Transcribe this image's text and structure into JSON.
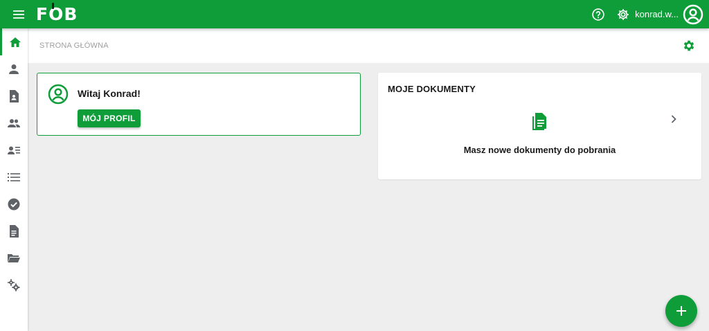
{
  "app": {
    "logo_text": "FOB",
    "brand_color": "#0f9d3a"
  },
  "header": {
    "menu_icon": "hamburger-icon",
    "help_icon": "help-circle-icon",
    "settings_icon": "gear-icon",
    "username": "konrad.w...",
    "avatar_icon": "account-circle-icon"
  },
  "sidebar": {
    "items": [
      {
        "name": "home",
        "icon": "home-icon",
        "active": true
      },
      {
        "name": "profile",
        "icon": "person-icon",
        "active": false
      },
      {
        "name": "document-person",
        "icon": "document-person-icon",
        "active": false
      },
      {
        "name": "people",
        "icon": "people-icon",
        "active": false
      },
      {
        "name": "contacts",
        "icon": "contact-list-icon",
        "active": false
      },
      {
        "name": "list",
        "icon": "list-icon",
        "active": false
      },
      {
        "name": "tasks",
        "icon": "check-circle-icon",
        "active": false
      },
      {
        "name": "documents",
        "icon": "document-icon",
        "active": false
      },
      {
        "name": "folders",
        "icon": "folder-open-icon",
        "active": false
      },
      {
        "name": "settings",
        "icon": "gears-icon",
        "active": false
      }
    ]
  },
  "breadcrumb": {
    "current": "STRONA GŁÓWNA"
  },
  "welcome": {
    "title": "Witaj Konrad!",
    "button_label": "MÓJ PROFIL"
  },
  "documents": {
    "title": "MOJE DOKUMENTY",
    "message": "Masz nowe dokumenty do pobrania"
  },
  "fab": {
    "icon": "plus-icon"
  }
}
